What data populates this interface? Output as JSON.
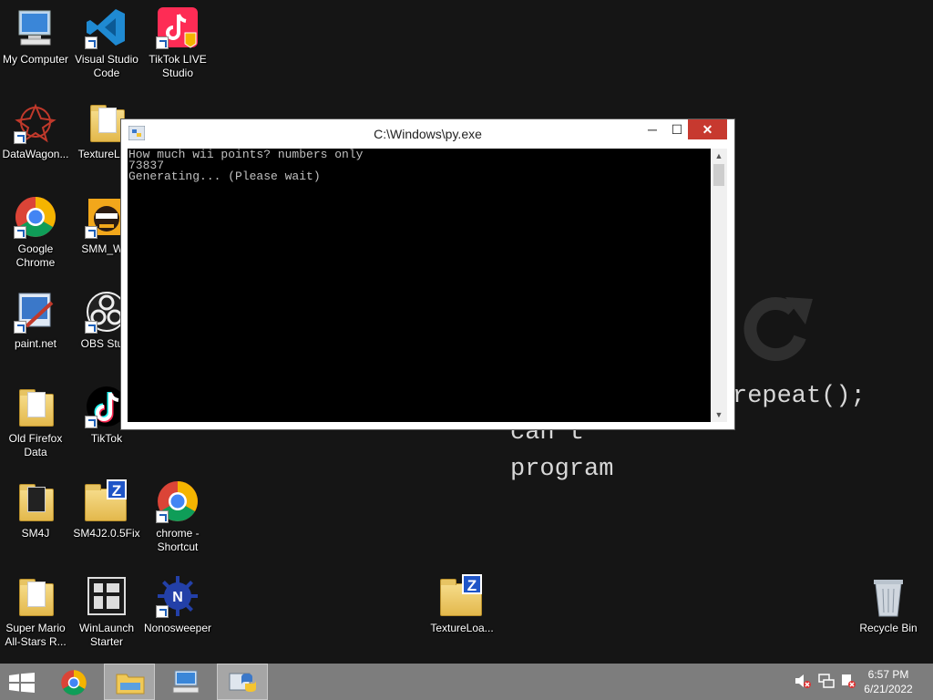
{
  "wallpaper": {
    "lines": [
      "repeat();",
      "can't",
      "program"
    ]
  },
  "desktop_icons": [
    {
      "label": "My Computer",
      "icon": "computer-icon"
    },
    {
      "label": "Visual Studio Code",
      "icon": "vscode-icon"
    },
    {
      "label": "TikTok LIVE Studio",
      "icon": "tiktok-live-icon"
    },
    {
      "label": "DataWagon...",
      "icon": "datawagon-icon"
    },
    {
      "label": "TextureLo...",
      "icon": "folder-icon"
    },
    {
      "label": "Google Chrome",
      "icon": "chrome-icon"
    },
    {
      "label": "SMM_W...",
      "icon": "smm-icon"
    },
    {
      "label": "paint.net",
      "icon": "paintnet-icon"
    },
    {
      "label": "OBS Stu...",
      "icon": "obs-icon"
    },
    {
      "label": "Old Firefox Data",
      "icon": "folder-icon"
    },
    {
      "label": "TikTok",
      "icon": "tiktok-icon"
    },
    {
      "label": "SM4J",
      "icon": "folder-icon"
    },
    {
      "label": "SM4J2.0.5Fix",
      "icon": "zip-folder-icon"
    },
    {
      "label": "chrome - Shortcut",
      "icon": "chrome-icon"
    },
    {
      "label": "Super Mario All-Stars R...",
      "icon": "folder-icon"
    },
    {
      "label": "WinLaunch Starter",
      "icon": "winlaunch-icon"
    },
    {
      "label": "Nonosweeper",
      "icon": "nonosweeper-icon"
    },
    {
      "label": "TextureLoa...",
      "icon": "zip-folder-icon"
    },
    {
      "label": "Recycle Bin",
      "icon": "recycle-bin-icon"
    }
  ],
  "window": {
    "title": "C:\\Windows\\py.exe",
    "minimize": "─",
    "maximize": "☐",
    "close": "✕",
    "console_lines": [
      "How much wii points? numbers only",
      "73837",
      "Generating... (Please wait)"
    ]
  },
  "taskbar": {
    "items": [
      "start-button",
      "chrome-icon",
      "file-explorer-icon",
      "network-computer-icon",
      "python-icon"
    ],
    "active": "python-icon",
    "time": "6:57 PM",
    "date": "6/21/2022"
  }
}
